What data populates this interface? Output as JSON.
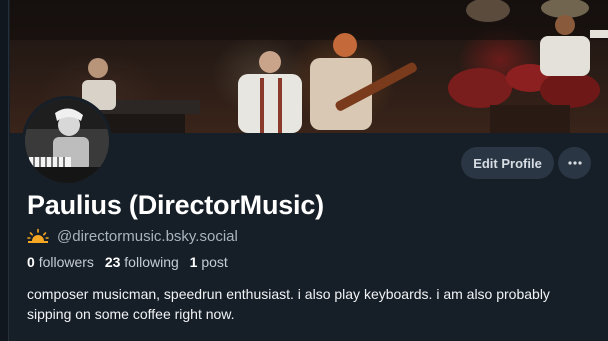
{
  "profile": {
    "display_name": "Paulius (DirectorMusic)",
    "handle": "@directormusic.bsky.social",
    "handle_badge_icon": "sunrise-icon",
    "bio": "composer musicman, speedrun enthusiast. i also play keyboards. i am also probably sipping on some coffee right now."
  },
  "stats": {
    "followers_count": "0",
    "followers_label": "followers",
    "following_count": "23",
    "following_label": "following",
    "posts_count": "1",
    "posts_label": "post"
  },
  "actions": {
    "edit_label": "Edit Profile",
    "more_icon": "ellipsis-icon"
  },
  "colors": {
    "background": "#161e27",
    "button": "#2a3644",
    "handle_text": "#a9b4bf",
    "sun_icon": "#f5a623"
  }
}
